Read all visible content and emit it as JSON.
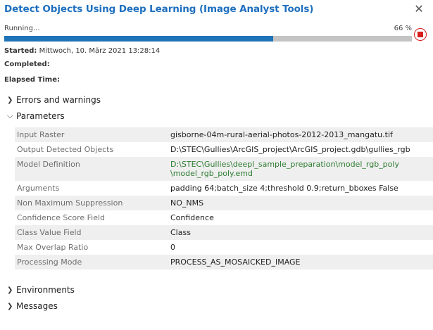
{
  "window": {
    "title": "Detect Objects Using Deep Learning (Image Analyst Tools)"
  },
  "progress": {
    "status": "Running...",
    "percent_label": "66 %",
    "fraction": 0.66
  },
  "meta": {
    "started_label": "Started:",
    "started_value": "Mittwoch, 10. März 2021 13:28:14",
    "completed_label": "Completed:",
    "elapsed_label": "Elapsed Time:"
  },
  "sections": {
    "errors": "Errors and warnings",
    "parameters": "Parameters",
    "environments": "Environments",
    "messages": "Messages"
  },
  "parameters": [
    {
      "key": "Input Raster",
      "value": [
        "gisborne-04m-rural-aerial-photos-2012-2013_mangatu.tif"
      ]
    },
    {
      "key": "Output Detected Objects",
      "value": [
        "D:\\STEC\\Gullies\\ArcGIS_project\\ArcGIS_project.gdb\\gullies_rgb"
      ]
    },
    {
      "key": "Model Definition",
      "value": [
        "D:\\STEC\\Gullies\\deepl_sample_preparation\\model_rgb_poly",
        "\\model_rgb_poly.emd"
      ],
      "link": true
    },
    {
      "key": "Arguments",
      "value": [
        "padding 64;batch_size 4;threshold 0.9;return_bboxes False"
      ]
    },
    {
      "key": "Non Maximum Suppression",
      "value": [
        "NO_NMS"
      ]
    },
    {
      "key": "Confidence Score Field",
      "value": [
        "Confidence"
      ]
    },
    {
      "key": "Class Value Field",
      "value": [
        "Class"
      ]
    },
    {
      "key": "Max Overlap Ratio",
      "value": [
        "0"
      ]
    },
    {
      "key": "Processing Mode",
      "value": [
        "PROCESS_AS_MOSAICKED_IMAGE"
      ]
    }
  ],
  "colors": {
    "title": "#1e6fbe",
    "progress_fill": "#1f73b7",
    "progress_track": "#c4c4c4",
    "stop": "#d81d1d",
    "path_link": "#2e7d32"
  },
  "icons": {
    "close": "close-icon",
    "stop": "stop-icon",
    "collapsed": "chevron-right-icon",
    "expanded": "chevron-down-icon"
  }
}
